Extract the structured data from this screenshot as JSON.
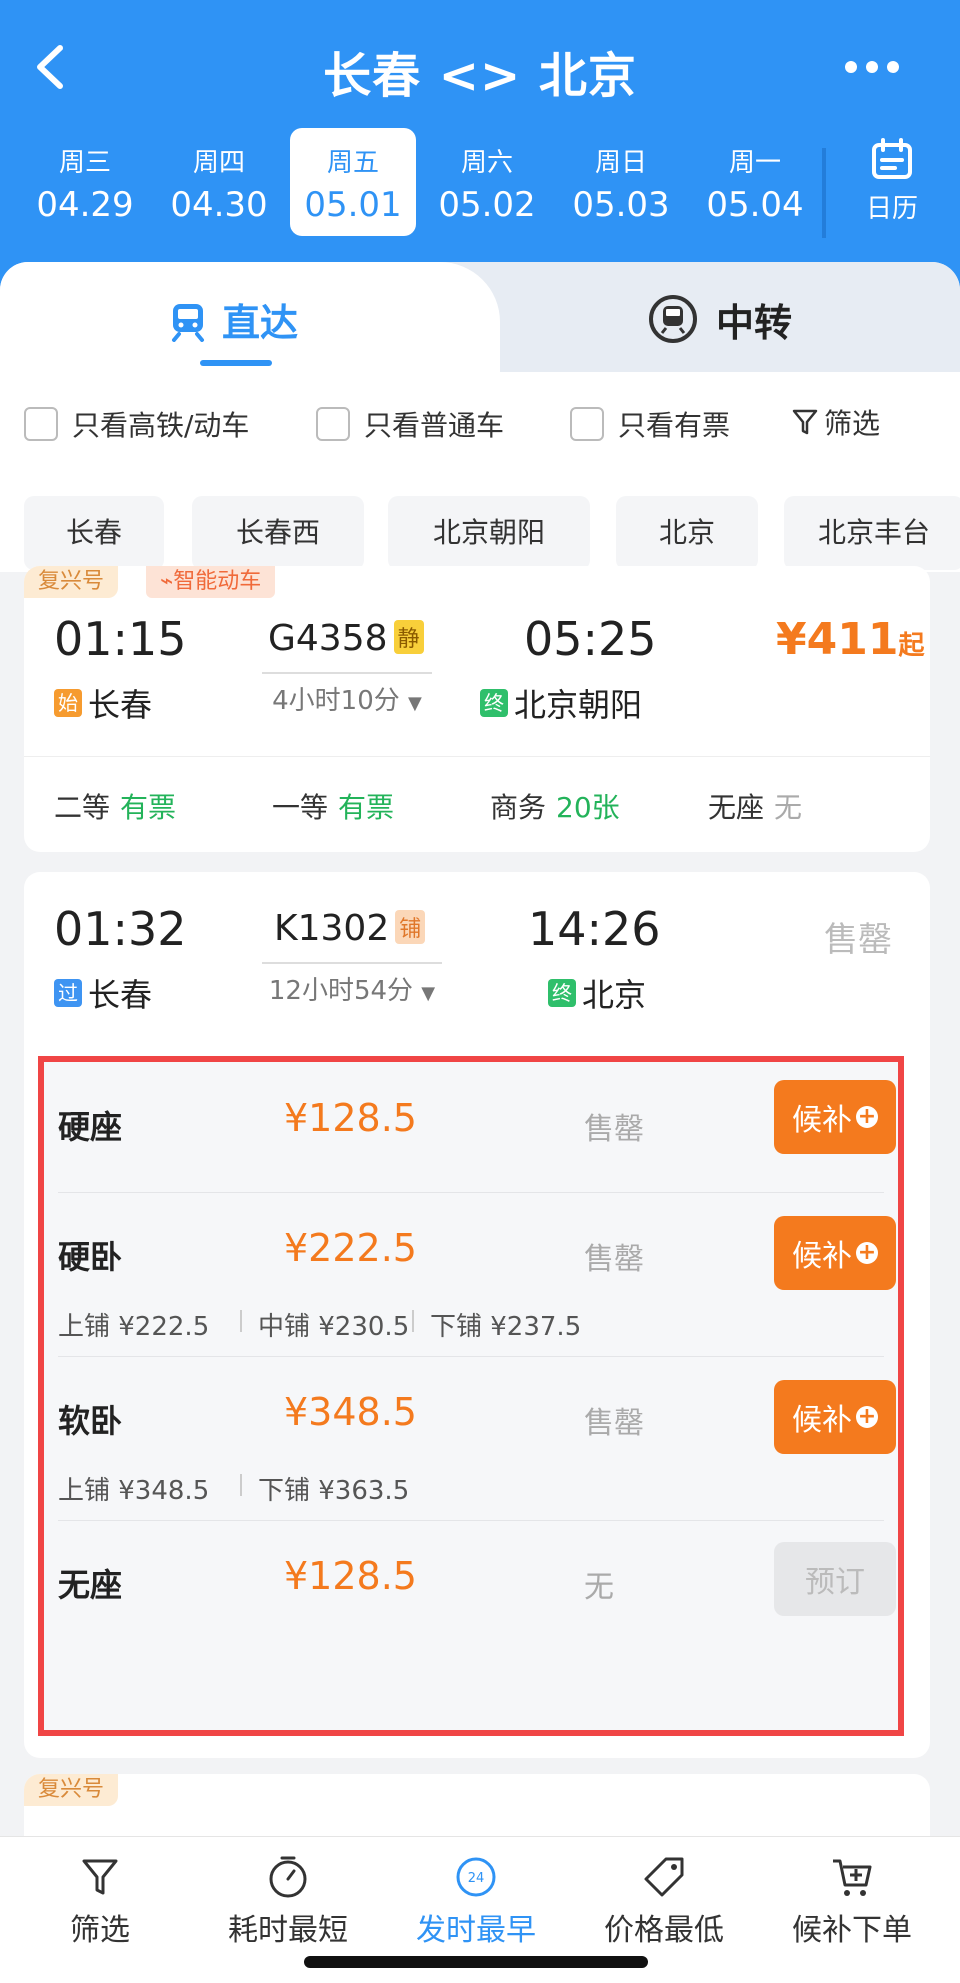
{
  "header": {
    "title": "长春 <> 北京"
  },
  "dates": [
    {
      "weekday": "周三",
      "date": "04.29"
    },
    {
      "weekday": "周四",
      "date": "04.30"
    },
    {
      "weekday": "周五",
      "date": "05.01"
    },
    {
      "weekday": "周六",
      "date": "05.02"
    },
    {
      "weekday": "周日",
      "date": "05.03"
    },
    {
      "weekday": "周一",
      "date": "05.04"
    }
  ],
  "calendar_label": "日历",
  "tabs": {
    "direct": "直达",
    "transfer": "中转"
  },
  "filters": {
    "gaotie": "只看高铁/动车",
    "putong": "只看普通车",
    "youpiao": "只看有票",
    "screen": "筛选"
  },
  "stations": [
    "长春",
    "长春西",
    "北京朝阳",
    "北京",
    "北京丰台"
  ],
  "train1": {
    "tag1": "复兴号",
    "tag2": "智能动车",
    "dep_time": "01:15",
    "arr_time": "05:25",
    "train_no": "G4358",
    "badge": "静",
    "duration": "4小时10分",
    "dep_badge": "始",
    "dep_station": "长春",
    "arr_badge": "终",
    "arr_station": "北京朝阳",
    "price": "¥411",
    "price_suffix": "起",
    "seats": [
      {
        "name": "二等",
        "status": "有票"
      },
      {
        "name": "一等",
        "status": "有票"
      },
      {
        "name": "商务",
        "status": "20张"
      },
      {
        "name": "无座",
        "status": "无"
      }
    ]
  },
  "train2": {
    "dep_time": "01:32",
    "arr_time": "14:26",
    "train_no": "K1302",
    "badge": "铺",
    "duration": "12小时54分",
    "dep_badge": "过",
    "dep_station": "长春",
    "arr_badge": "终",
    "arr_station": "北京",
    "status": "售罄",
    "seat_rows": [
      {
        "name": "硬座",
        "price": "¥128.5",
        "status": "售罄",
        "button": "候补"
      },
      {
        "name": "硬卧",
        "price": "¥222.5",
        "status": "售罄",
        "button": "候补",
        "berths": [
          "上铺 ¥222.5",
          "中铺 ¥230.5",
          "下铺 ¥237.5"
        ]
      },
      {
        "name": "软卧",
        "price": "¥348.5",
        "status": "售罄",
        "button": "候补",
        "berths": [
          "上铺 ¥348.5",
          "下铺 ¥363.5"
        ]
      },
      {
        "name": "无座",
        "price": "¥128.5",
        "status": "无",
        "button": "预订"
      }
    ]
  },
  "train3": {
    "tag1": "复兴号"
  },
  "bottom_nav": [
    {
      "label": "筛选"
    },
    {
      "label": "耗时最短"
    },
    {
      "label": "发时最早"
    },
    {
      "label": "价格最低"
    },
    {
      "label": "候补下单"
    }
  ],
  "colors": {
    "primary": "#2f93f5",
    "price": "#f47a1e",
    "available": "#23b35a",
    "highlight_border": "#f04545"
  }
}
